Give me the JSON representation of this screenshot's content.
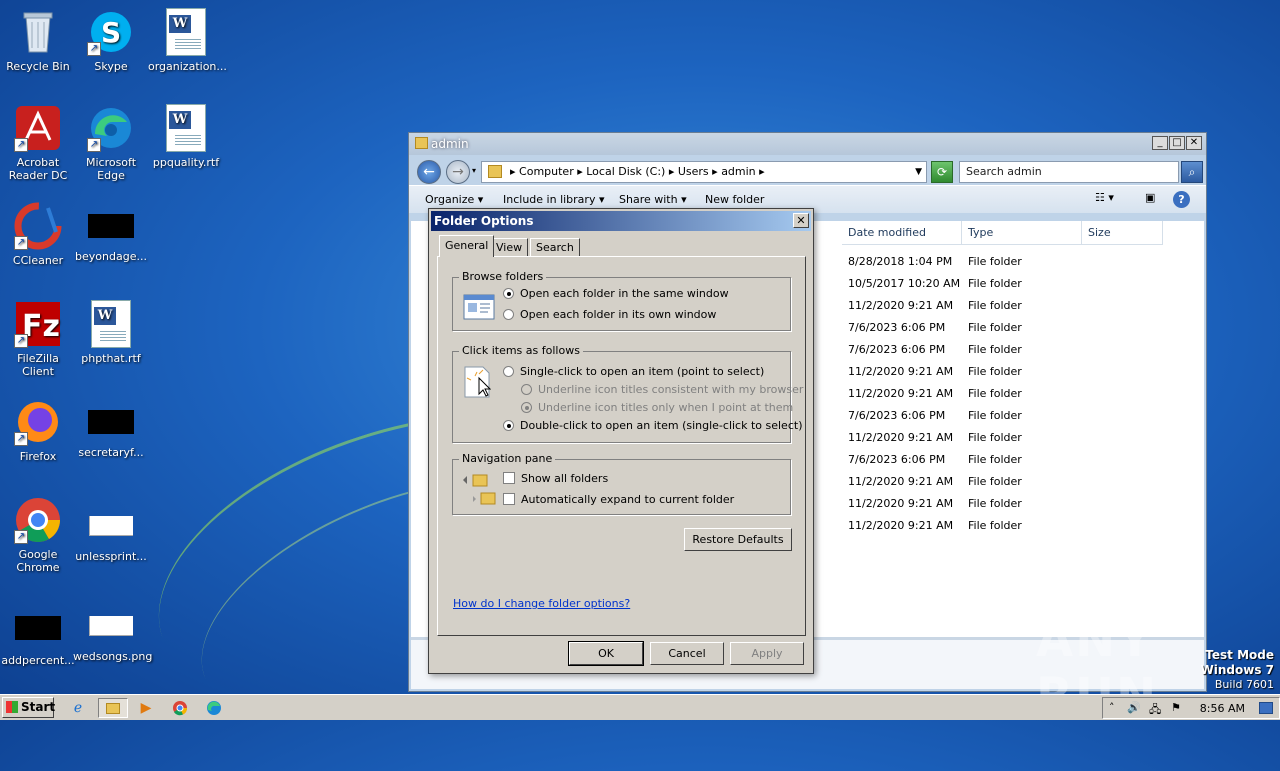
{
  "desktop": {
    "icons": [
      {
        "label": "Recycle Bin"
      },
      {
        "label": "Skype"
      },
      {
        "label": "organization..."
      },
      {
        "label": "Acrobat Reader DC"
      },
      {
        "label": "Microsoft Edge"
      },
      {
        "label": "ppquality.rtf"
      },
      {
        "label": "CCleaner"
      },
      {
        "label": "beyondage..."
      },
      {
        "label": "FileZilla Client"
      },
      {
        "label": "phpthat.rtf"
      },
      {
        "label": "Firefox"
      },
      {
        "label": "secretaryf..."
      },
      {
        "label": "Google Chrome"
      },
      {
        "label": "unlessprint..."
      },
      {
        "label": "addpercent..."
      },
      {
        "label": "wedsongs.png"
      }
    ]
  },
  "explorer": {
    "title": "admin",
    "address": [
      "Computer",
      "Local Disk (C:)",
      "Users",
      "admin"
    ],
    "search_placeholder": "Search admin",
    "commands": [
      "Organize",
      "Include in library",
      "Share with",
      "New folder"
    ],
    "columns": [
      "Date modified",
      "Type",
      "Size"
    ],
    "rows": [
      {
        "date": "8/28/2018 1:04 PM",
        "type": "File folder"
      },
      {
        "date": "10/5/2017 10:20 AM",
        "type": "File folder"
      },
      {
        "date": "11/2/2020 9:21 AM",
        "type": "File folder"
      },
      {
        "date": "7/6/2023 6:06 PM",
        "type": "File folder"
      },
      {
        "date": "7/6/2023 6:06 PM",
        "type": "File folder"
      },
      {
        "date": "11/2/2020 9:21 AM",
        "type": "File folder"
      },
      {
        "date": "11/2/2020 9:21 AM",
        "type": "File folder"
      },
      {
        "date": "7/6/2023 6:06 PM",
        "type": "File folder"
      },
      {
        "date": "11/2/2020 9:21 AM",
        "type": "File folder"
      },
      {
        "date": "7/6/2023 6:06 PM",
        "type": "File folder"
      },
      {
        "date": "11/2/2020 9:21 AM",
        "type": "File folder"
      },
      {
        "date": "11/2/2020 9:21 AM",
        "type": "File folder"
      },
      {
        "date": "11/2/2020 9:21 AM",
        "type": "File folder"
      }
    ]
  },
  "dialog": {
    "title": "Folder Options",
    "tabs": [
      "General",
      "View",
      "Search"
    ],
    "browse": {
      "label": "Browse folders",
      "same_window": "Open each folder in the same window",
      "own_window": "Open each folder in its own window"
    },
    "click": {
      "label": "Click items as follows",
      "single": "Single-click to open an item (point to select)",
      "underline_browser": "Underline icon titles consistent with my browser",
      "underline_point": "Underline icon titles only when I point at them",
      "double": "Double-click to open an item (single-click to select)"
    },
    "nav": {
      "label": "Navigation pane",
      "show_all": "Show all folders",
      "auto_expand": "Automatically expand to current folder"
    },
    "restore_defaults": "Restore Defaults",
    "help_link": "How do I change folder options?",
    "ok": "OK",
    "cancel": "Cancel",
    "apply": "Apply"
  },
  "taskbar": {
    "start": "Start",
    "clock": "8:56 AM"
  },
  "watermark": {
    "line1": "Test Mode",
    "line2": "Windows 7",
    "line3": "Build 7601",
    "brand": "ANY RUN"
  }
}
